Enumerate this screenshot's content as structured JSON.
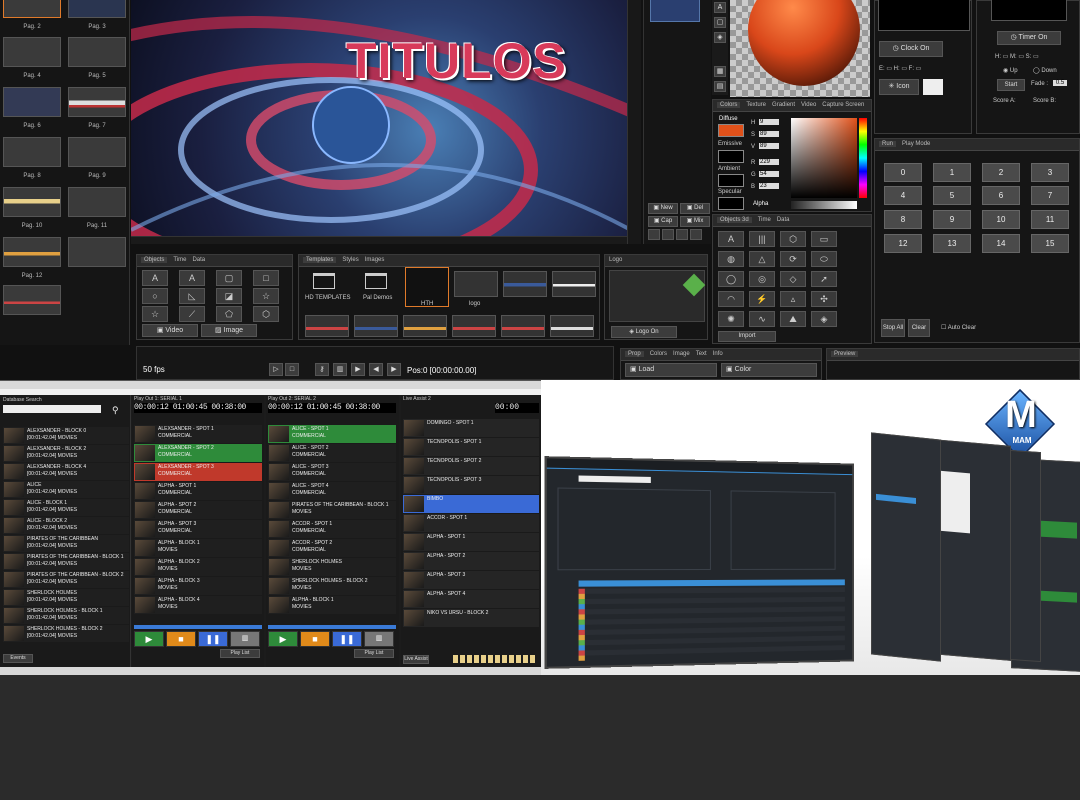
{
  "top": {
    "pages": [
      "Pag. 2",
      "Pag. 3",
      "Pag. 4",
      "Pag. 5",
      "Pag. 6",
      "Pag. 7",
      "Pag. 8",
      "Pag. 9",
      "Pag. 10",
      "Pag. 11",
      "Pag. 12"
    ],
    "preview_title": "TITULOS",
    "objects_tabs": [
      "Objects",
      "Time",
      "Data"
    ],
    "objects_glyphs": [
      "A",
      "A",
      "▢",
      "□",
      "○",
      "◺",
      "◪",
      "☆",
      "☆",
      "⬠",
      "⬡"
    ],
    "video_label": "Video",
    "image_label": "Image",
    "templates_tabs": [
      "Templates",
      "Styles",
      "Images"
    ],
    "templates": [
      "HD TEMPLATES",
      "Pal Demos",
      "HTH",
      "logo"
    ],
    "logo_title": "Logo",
    "logo_on": "Logo On",
    "fps": "50 fps",
    "pos": "Pos:0 [00:00:00.00]",
    "new_label": "New",
    "del_label": "Del",
    "cap_label": "Cap",
    "mix_label": "Mix",
    "colors_tabs": [
      "Colors",
      "Texture",
      "Gradient",
      "Video",
      "Capture Screen"
    ],
    "diffuse": "Diffuse",
    "emissive": "Emissive",
    "ambient": "Ambient",
    "specular": "Specular",
    "alpha": "Alpha",
    "hsv_labels": [
      "H",
      "S",
      "V",
      "R",
      "G",
      "B"
    ],
    "hsv_values": [
      "9",
      "89",
      "89",
      "229",
      "54",
      "23"
    ],
    "objects3d_tabs": [
      "Objects 3d",
      "Time",
      "Data"
    ],
    "import_label": "Import",
    "clock_on": "Clock On",
    "icon_label": "Icon",
    "timer_on": "Timer On",
    "up": "Up",
    "down": "Down",
    "start": "Start",
    "fade_label": "Fade :",
    "fade_value": "0.5",
    "score_a": "Score A:",
    "score_b": "Score B:",
    "run_tabs": [
      "Run",
      "Play Mode"
    ],
    "run_numbers": [
      "0",
      "1",
      "2",
      "3",
      "4",
      "5",
      "6",
      "7",
      "8",
      "9",
      "10",
      "11",
      "12",
      "13",
      "14",
      "15"
    ],
    "stop_all": "Stop All",
    "clear": "Clear",
    "auto_clear": "Auto Clear",
    "prop_tabs": [
      "Prop",
      "Colors",
      "Image",
      "Text",
      "Info"
    ],
    "load_label": "Load",
    "color_label": "Color",
    "preview_label": "Preview"
  },
  "playout": {
    "db_title": "Database Search",
    "db_items": [
      {
        "t": "ALEXSANDER - BLOCK 0",
        "s": "[00:01:42.04] MOVIES"
      },
      {
        "t": "ALEXSANDER - BLOCK 2",
        "s": "[00:01:42.04] MOVIES"
      },
      {
        "t": "ALEXSANDER - BLOCK 4",
        "s": "[00:01:42.04] MOVIES"
      },
      {
        "t": "ALICE",
        "s": "[00:01:42.04] MOVIES"
      },
      {
        "t": "ALICE - BLOCK 1",
        "s": "[00:01:42.04] MOVIES"
      },
      {
        "t": "ALICE - BLOCK 2",
        "s": "[00:01:42.04] MOVIES"
      },
      {
        "t": "PIRATES OF THE CARIBBEAN",
        "s": "[00:01:42.04] MOVIES"
      },
      {
        "t": "PIRATES OF THE CARIBBEAN - BLOCK 1",
        "s": "[00:01:42.04] MOVIES"
      },
      {
        "t": "PIRATES OF THE CARIBBEAN - BLOCK 2",
        "s": "[00:01:42.04] MOVIES"
      },
      {
        "t": "SHERLOCK HOLMES",
        "s": "[00:01:42.04] MOVIES"
      },
      {
        "t": "SHERLOCK HOLMES - BLOCK 1",
        "s": "[00:01:42.04] MOVIES"
      },
      {
        "t": "SHERLOCK HOLMES - BLOCK 2",
        "s": "[00:01:42.04] MOVIES"
      }
    ],
    "events_label": "Events",
    "po1_title": "Play Out 1: SERIAL 1",
    "po2_title": "Play Out 2: SERIAL 2",
    "live_title": "Live Assist 2",
    "po1_items": [
      {
        "t": "ALEXSANDER - SPOT 1",
        "s": "COMMERCIAL"
      },
      {
        "t": "ALEXSANDER - SPOT 2",
        "s": "COMMERCIAL"
      },
      {
        "t": "ALEXSANDER - SPOT 3",
        "s": "COMMERCIAL"
      },
      {
        "t": "ALPHA - SPOT 1",
        "s": "COMMERCIAL"
      },
      {
        "t": "ALPHA - SPOT 2",
        "s": "COMMERCIAL"
      },
      {
        "t": "ALPHA - SPOT 3",
        "s": "COMMERCIAL"
      },
      {
        "t": "ALPHA - BLOCK 1",
        "s": "MOVIES"
      },
      {
        "t": "ALPHA - BLOCK 2",
        "s": "MOVIES"
      },
      {
        "t": "ALPHA - BLOCK 3",
        "s": "MOVIES"
      },
      {
        "t": "ALPHA - BLOCK 4",
        "s": "MOVIES"
      }
    ],
    "po2_items": [
      {
        "t": "ALICE - SPOT 1",
        "s": "COMMERCIAL"
      },
      {
        "t": "ALICE - SPOT 2",
        "s": "COMMERCIAL"
      },
      {
        "t": "ALICE - SPOT 3",
        "s": "COMMERCIAL"
      },
      {
        "t": "ALICE - SPOT 4",
        "s": "COMMERCIAL"
      },
      {
        "t": "PIRATES OF THE CARIBBEAN - BLOCK 1",
        "s": "MOVIES"
      },
      {
        "t": "ACCOR - SPOT 1",
        "s": "COMMERCIAL"
      },
      {
        "t": "ACCOR - SPOT 2",
        "s": "COMMERCIAL"
      },
      {
        "t": "SHERLOCK HOLMES",
        "s": "MOVIES"
      },
      {
        "t": "SHERLOCK HOLMES - BLOCK 2",
        "s": "MOVIES"
      },
      {
        "t": "ALPHA - BLOCK 1",
        "s": "MOVIES"
      }
    ],
    "live_items": [
      "DOMINGO - SPOT 1",
      "TECNOPOLIS - SPOT 1",
      "TECNOPOLIS - SPOT 2",
      "TECNOPOLIS - SPOT 3",
      "BIMBO",
      "ACCOR - SPOT 1",
      "ALPHA - SPOT 1",
      "ALPHA - SPOT 2",
      "ALPHA - SPOT 3",
      "ALPHA - SPOT 4",
      "NIKO VS URSU - BLOCK 2"
    ],
    "play_list": "Play List",
    "live_assist_btn": "Live Assist"
  },
  "mam": {
    "logo_letter": "M",
    "logo_text": "MAM",
    "colors": {
      "accent": "#3a8fd6",
      "green": "#2e8b3a"
    }
  }
}
